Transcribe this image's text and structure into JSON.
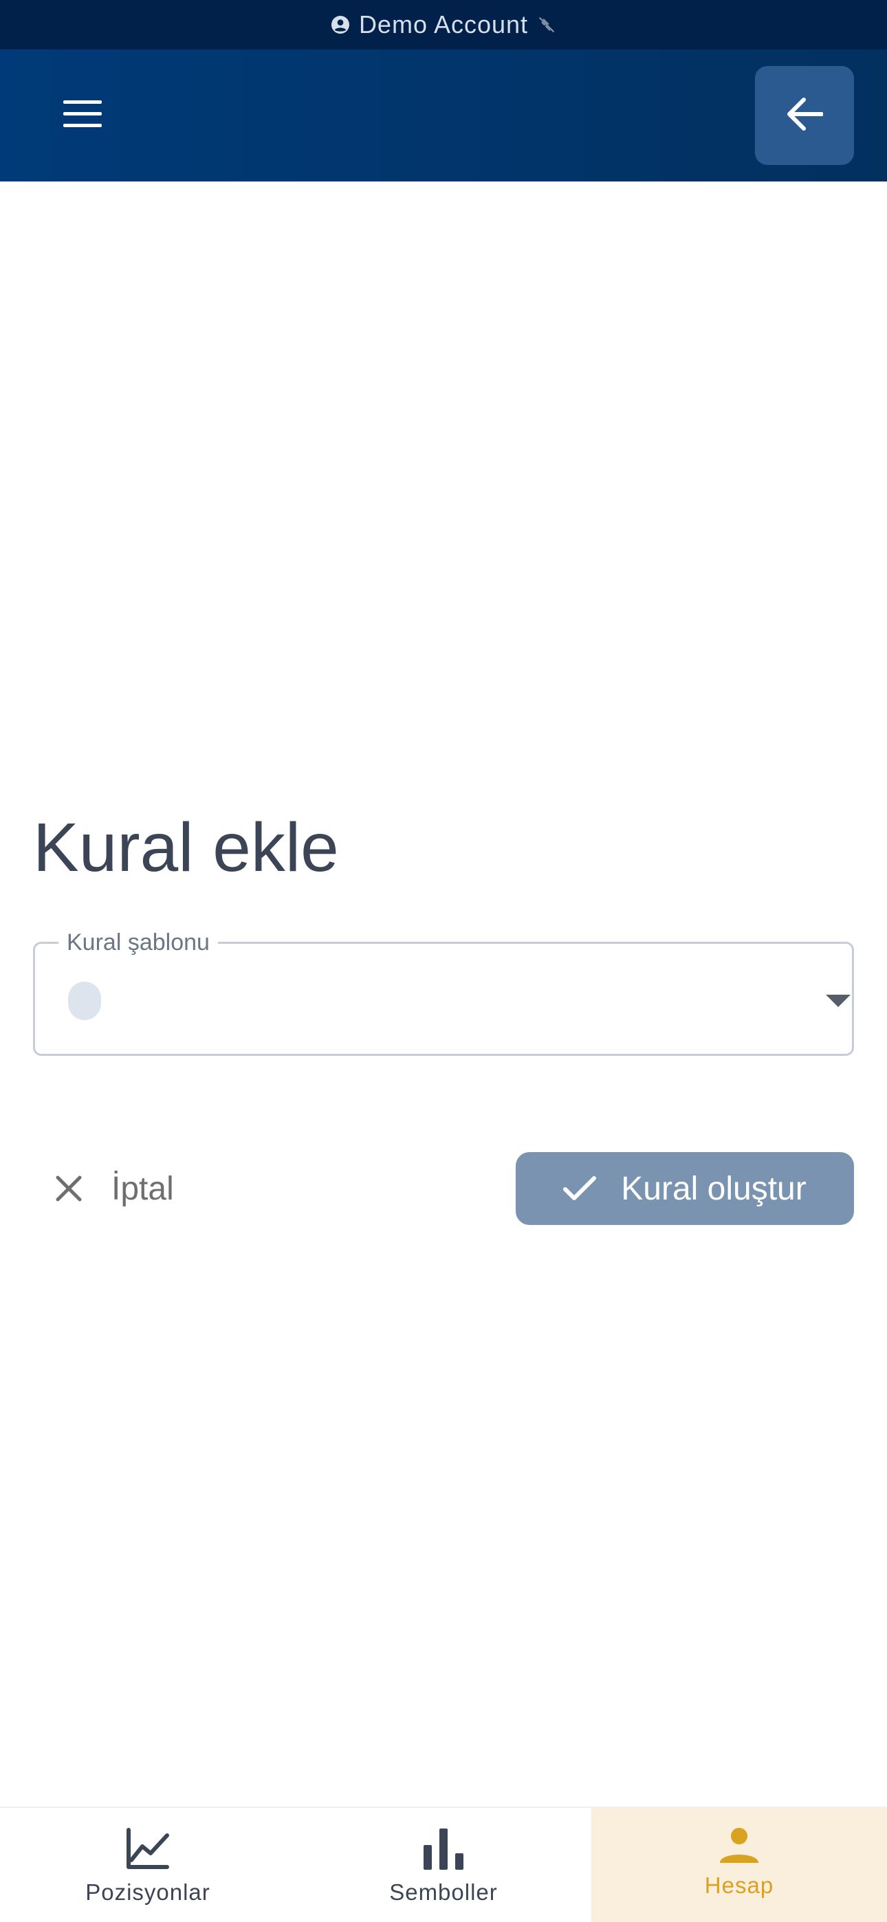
{
  "status_bar": {
    "account_label": "Demo Account"
  },
  "app_bar": {
    "menu_icon": "hamburger-menu-icon",
    "back_icon": "arrow-left-icon"
  },
  "main": {
    "title": "Kural ekle",
    "template_field": {
      "label": "Kural şablonu",
      "value": ""
    },
    "cancel_label": "İptal",
    "create_label": "Kural oluştur"
  },
  "bottom_nav": {
    "items": [
      {
        "label": "Pozisyonlar",
        "icon": "line-chart-icon",
        "active": false
      },
      {
        "label": "Semboller",
        "icon": "bar-chart-icon",
        "active": false
      },
      {
        "label": "Hesap",
        "icon": "person-icon",
        "active": true
      }
    ]
  },
  "colors": {
    "status_bg": "#02214a",
    "app_bar_bg": "#003a78",
    "back_button_bg": "#2a5a8f",
    "primary_button_bg": "#7a93b1",
    "active_nav_bg": "#f9efdc",
    "active_nav_fg": "#d9a21f",
    "title_text": "#3b4556"
  }
}
